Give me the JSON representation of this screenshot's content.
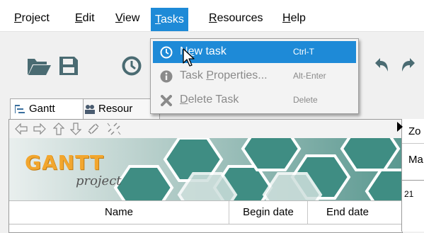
{
  "menubar": {
    "items": [
      {
        "label": "Project",
        "mnemonic": "P",
        "rest": "roject"
      },
      {
        "label": "Edit",
        "mnemonic": "E",
        "rest": "dit"
      },
      {
        "label": "View",
        "mnemonic": "V",
        "rest": "iew"
      },
      {
        "label": "Tasks",
        "mnemonic": "T",
        "rest": "asks"
      },
      {
        "label": "Resources",
        "mnemonic": "R",
        "rest": "esources"
      },
      {
        "label": "Help",
        "mnemonic": "H",
        "rest": "elp"
      }
    ],
    "active": "Tasks"
  },
  "toolbar": {
    "icons": [
      "open-folder-icon",
      "save-icon",
      "clock-icon",
      "undo-icon",
      "redo-icon"
    ]
  },
  "tabs": [
    {
      "label": "Gantt",
      "icon": "gantt-icon"
    },
    {
      "label": "Resour",
      "icon": "resources-icon"
    }
  ],
  "tasks_menu": {
    "items": [
      {
        "pre": "N",
        "mn": "e",
        "post": "w task",
        "shortcut": "Ctrl-T",
        "icon": "clock-icon",
        "selected": true,
        "enabled": true
      },
      {
        "pre": "Task ",
        "mn": "P",
        "post": "roperties...",
        "shortcut": "Alt-Enter",
        "icon": "info-icon",
        "selected": false,
        "enabled": false
      },
      {
        "pre": "",
        "mn": "D",
        "post": "elete Task",
        "shortcut": "Delete",
        "icon": "delete-icon",
        "selected": false,
        "enabled": false
      }
    ]
  },
  "panel": {
    "arrow_icons": [
      "arrow-left-icon",
      "arrow-right-icon",
      "arrow-up-icon",
      "arrow-down-icon",
      "link-icon",
      "unlink-icon"
    ],
    "logo": {
      "word1": "GANTT",
      "word2": "project"
    },
    "columns": [
      "Name",
      "Begin date",
      "End date"
    ]
  },
  "chart_pane": {
    "zoom_label": "Zo",
    "month_label": "Ma",
    "day_label": "21"
  },
  "colors": {
    "accent": "#1e8ad7",
    "logo_orange": "#f0a030",
    "banner_teal": "#3f8d83"
  }
}
